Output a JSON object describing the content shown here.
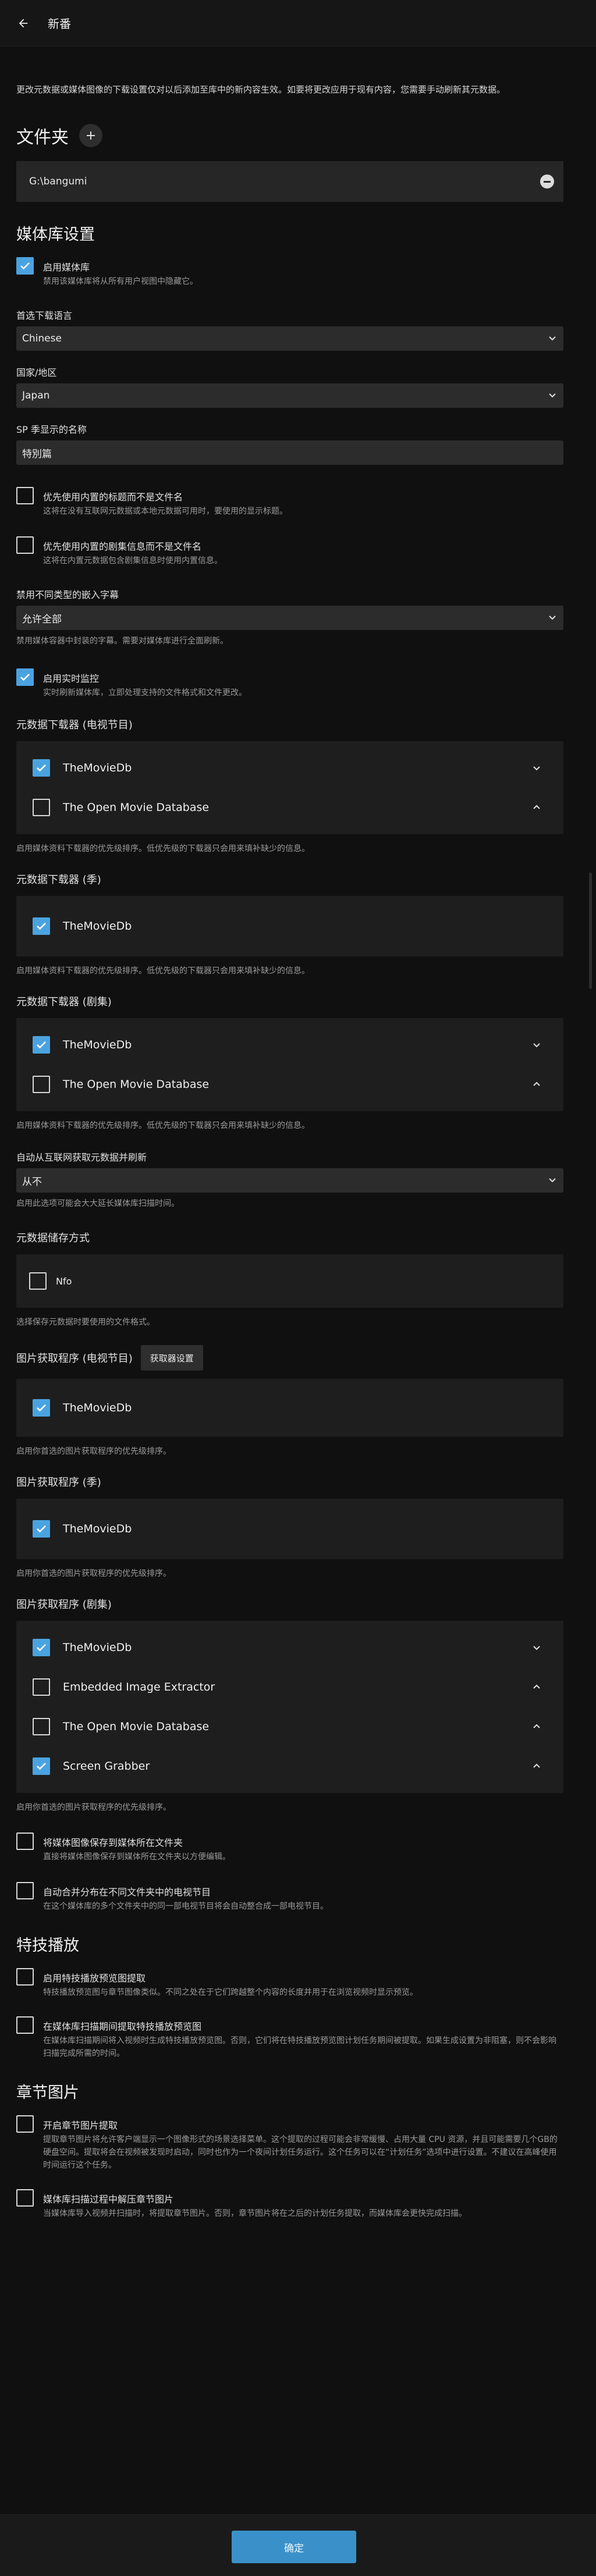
{
  "header": {
    "title": "新番"
  },
  "notice": "更改元数据或媒体图像的下载设置仅对以后添加至库中的新内容生效。如要将更改应用于现有内容，您需要手动刷新其元数据。",
  "folders": {
    "title": "文件夹",
    "path": "G:\\bangumi"
  },
  "library": {
    "title": "媒体库设置",
    "enable": {
      "label": "启用媒体库",
      "hint": "禁用该媒体库将从所有用户视图中隐藏它。"
    },
    "language": {
      "label": "首选下载语言",
      "value": "Chinese"
    },
    "country": {
      "label": "国家/地区",
      "value": "Japan"
    },
    "sp": {
      "label": "SP 季显示的名称",
      "value": "特別篇"
    },
    "embedded_title": {
      "label": "优先使用内置的标题而不是文件名",
      "hint": "这将在没有互联网元数据或本地元数据可用时，要使用的显示标题。"
    },
    "embedded_episode": {
      "label": "优先使用内置的剧集信息而不是文件名",
      "hint": "这将在内置元数据包含剧集信息时使用内置信息。"
    },
    "subtitle": {
      "label": "禁用不同类型的嵌入字幕",
      "value": "允许全部",
      "hint": "禁用媒体容器中封装的字幕。需要对媒体库进行全面刷新。"
    },
    "realtime": {
      "label": "启用实时监控",
      "hint": "实时刷新媒体库，立即处理支持的文件格式和文件更改。"
    }
  },
  "meta_series": {
    "title": "元数据下载器 (电视节目)",
    "items": [
      "TheMovieDb",
      "The Open Movie Database"
    ],
    "hint": "启用媒体资料下载器的优先级排序。低优先级的下载器只会用来填补缺少的信息。"
  },
  "meta_season": {
    "title": "元数据下载器 (季)",
    "items": [
      "TheMovieDb"
    ],
    "hint": "启用媒体资料下载器的优先级排序。低优先级的下载器只会用来填补缺少的信息。"
  },
  "meta_episode": {
    "title": "元数据下载器 (剧集)",
    "items": [
      "TheMovieDb",
      "The Open Movie Database"
    ],
    "hint": "启用媒体资料下载器的优先级排序。低优先级的下载器只会用来填补缺少的信息。"
  },
  "auto_refresh": {
    "label": "自动从互联网获取元数据并刷新",
    "value": "从不",
    "hint": "启用此选项可能会大大延长媒体库扫描时间。"
  },
  "savers": {
    "title": "元数据储存方式",
    "items": [
      "Nfo"
    ],
    "hint": "选择保存元数据时要使用的文件格式。"
  },
  "img_series": {
    "title": "图片获取程序 (电视节目)",
    "button": "获取器设置",
    "items": [
      "TheMovieDb"
    ],
    "hint": "启用你首选的图片获取程序的优先级排序。"
  },
  "img_season": {
    "title": "图片获取程序 (季)",
    "items": [
      "TheMovieDb"
    ],
    "hint": "启用你首选的图片获取程序的优先级排序。"
  },
  "img_episode": {
    "title": "图片获取程序 (剧集)",
    "items": [
      "TheMovieDb",
      "Embedded Image Extractor",
      "The Open Movie Database",
      "Screen Grabber"
    ],
    "hint": "启用你首选的图片获取程序的优先级排序。"
  },
  "save_local": {
    "label": "将媒体图像保存到媒体所在文件夹",
    "hint": "直接将媒体图像保存到媒体所在文件夹以方便编辑。"
  },
  "merge": {
    "label": "自动合并分布在不同文件夹中的电视节目",
    "hint": "在这个媒体库的多个文件夹中的同一部电视节目将会自动整合成一部电视节目。"
  },
  "trickplay": {
    "title": "特技播放",
    "extract": {
      "label": "启用特技播放预览图提取",
      "hint": "特技播放预览图与章节图像类似。不同之处在于它们跨越整个内容的长度并用于在浏览视频时显示预览。"
    },
    "scan": {
      "label": "在媒体库扫描期间提取特技播放预览图",
      "hint": "在媒体库扫描期间将入视频时生成特技播放预览图。否则，它们将在特技播放预览图计划任务期间被提取。如果生成设置为非阻塞，则不会影响扫描完成所需的时间。"
    }
  },
  "chapters": {
    "title": "章节图片",
    "extract": {
      "label": "开启章节图片提取",
      "hint": "提取章节图片将允许客户端显示一个图像形式的场景选择菜单。这个提取的过程可能会非常缓慢、占用大量 CPU 资源，并且可能需要几个GB的硬盘空间。提取将会在视频被发现时启动，同时也作为一个夜间计划任务运行。这个任务可以在“计划任务”选项中进行设置。不建议在高峰使用时间运行这个任务。"
    },
    "scan": {
      "label": "媒体库扫描过程中解压章节图片",
      "hint": "当媒体库导入视频并扫描时，将提取章节图片。否则，章节图片将在之后的计划任务提取，而媒体库会更快完成扫描。"
    }
  },
  "footer": {
    "ok": "确定"
  },
  "colors": {
    "accent": "#4aa3e0",
    "button": "#3a91c9"
  }
}
